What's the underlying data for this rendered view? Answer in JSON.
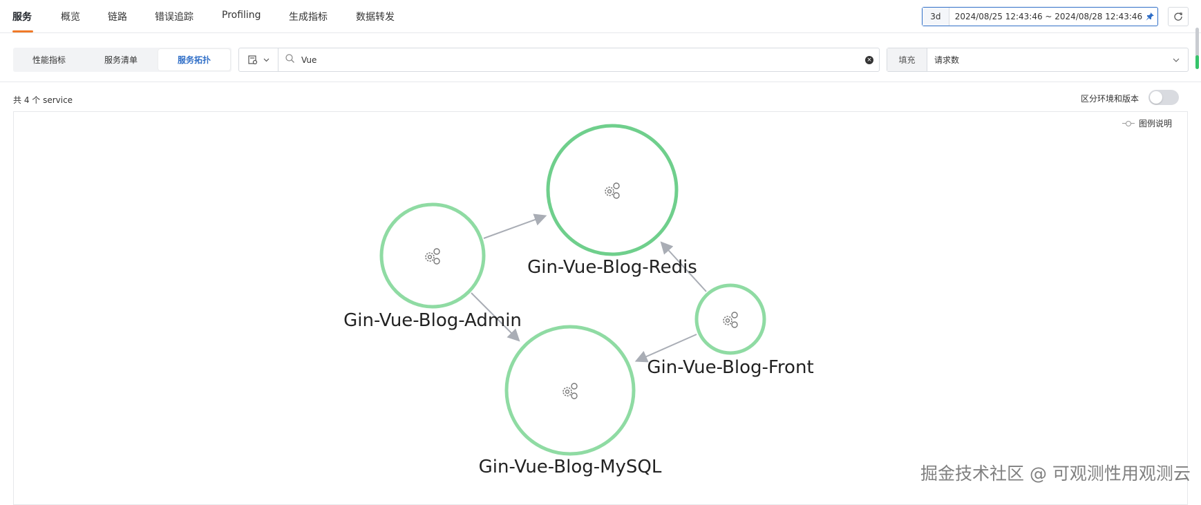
{
  "nav": {
    "tabs": [
      "服务",
      "概览",
      "链路",
      "错误追踪",
      "Profiling",
      "生成指标",
      "数据转发"
    ],
    "time_quick": "3d",
    "time_range": "2024/08/25 12:43:46 ~ 2024/08/28 12:43:46",
    "pin_icon": "pin-icon",
    "refresh_icon": "refresh-icon"
  },
  "view_tabs": [
    "性能指标",
    "服务清单",
    "服务拓扑"
  ],
  "filter": {
    "type_icon": "filter-source-icon",
    "search_value": "Vue"
  },
  "fill": {
    "label": "填充",
    "value": "请求数"
  },
  "summary": "共 4 个 service",
  "toggle": {
    "label": "区分环境和版本",
    "on": false
  },
  "legend_label": "图例说明",
  "topology": {
    "node_color": "#6fcf8c",
    "edge_color": "#a9adb5",
    "nodes": [
      {
        "id": "redis",
        "label": "Gin-Vue-Blog-Redis"
      },
      {
        "id": "admin",
        "label": "Gin-Vue-Blog-Admin"
      },
      {
        "id": "front",
        "label": "Gin-Vue-Blog-Front"
      },
      {
        "id": "mysql",
        "label": "Gin-Vue-Blog-MySQL"
      }
    ],
    "edges": [
      {
        "from": "admin",
        "to": "redis"
      },
      {
        "from": "admin",
        "to": "mysql"
      },
      {
        "from": "front",
        "to": "redis"
      },
      {
        "from": "front",
        "to": "mysql"
      }
    ]
  },
  "watermark": "掘金技术社区 @ 可观测性用观测云"
}
